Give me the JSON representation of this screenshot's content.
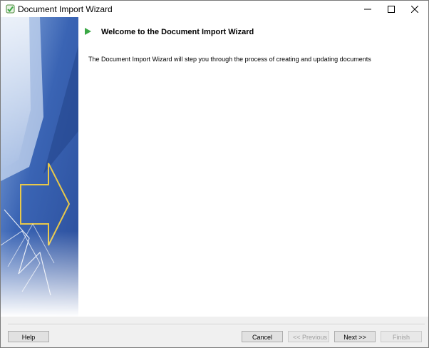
{
  "window": {
    "title": "Document Import Wizard"
  },
  "content": {
    "heading": "Welcome to the Document Import Wizard",
    "description": "The Document Import Wizard will step you through the process of creating and updating documents"
  },
  "footer": {
    "help_label": "Help",
    "cancel_label": "Cancel",
    "previous_label": "<< Previous",
    "next_label": "Next >>",
    "finish_label": "Finish"
  },
  "icons": {
    "app": "wizard-app-icon",
    "heading": "green-play-icon",
    "minimize": "minimize-icon",
    "maximize": "maximize-icon",
    "close": "close-icon"
  },
  "colors": {
    "accent_green": "#3aa845",
    "banner_blue": "#3a64b4",
    "arrow_gold": "#e8c84a"
  }
}
